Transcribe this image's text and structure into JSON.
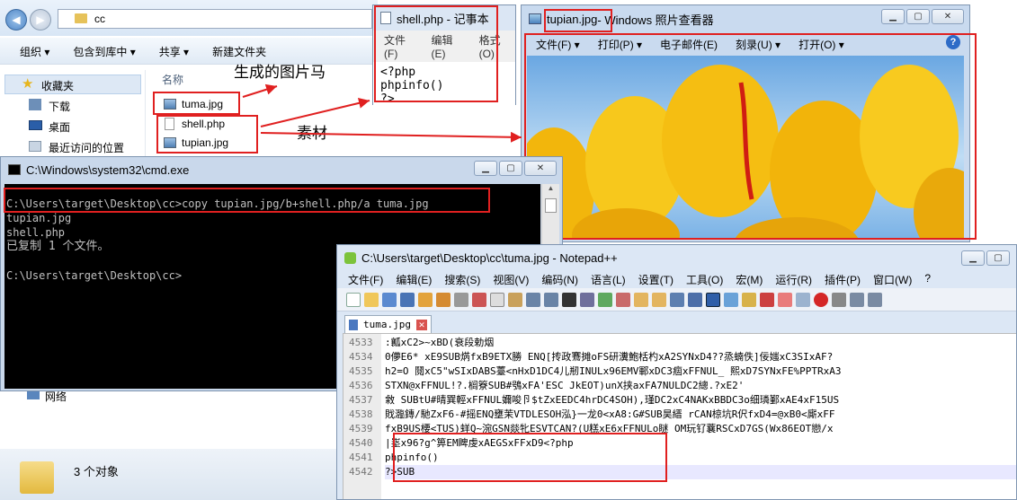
{
  "explorer": {
    "path": "cc",
    "toolbar": [
      "组织 ▾",
      "包含到库中 ▾",
      "共享 ▾",
      "新建文件夹"
    ],
    "column": "名称",
    "sidebar": [
      "收藏夹",
      "下载",
      "桌面",
      "最近访问的位置"
    ],
    "files": [
      "tuma.jpg",
      "shell.php",
      "tupian.jpg"
    ],
    "network": "网络",
    "count": "3 个对象"
  },
  "annotations": {
    "generated": "生成的图片马",
    "material": "素材"
  },
  "notepad": {
    "title": "shell.php - 记事本",
    "menu": [
      "文件(F)",
      "编辑(E)",
      "格式(O)"
    ],
    "lines": [
      "<?php",
      "phpinfo()",
      "?>"
    ]
  },
  "viewer": {
    "title_file": "tupian.jpg",
    "title_rest": " - Windows 照片查看器",
    "menu": [
      "文件(F) ▾",
      "打印(P) ▾",
      "电子邮件(E)",
      "刻录(U) ▾",
      "打开(O) ▾"
    ]
  },
  "cmd": {
    "title": "C:\\Windows\\system32\\cmd.exe",
    "command": "C:\\Users\\target\\Desktop\\cc>copy tupian.jpg/b+shell.php/a tuma.jpg",
    "out1": "tupian.jpg",
    "out2": "shell.php",
    "out3": "已复制         1 个文件。",
    "prompt": "C:\\Users\\target\\Desktop\\cc>"
  },
  "npp": {
    "title": "C:\\Users\\target\\Desktop\\cc\\tuma.jpg - Notepad++",
    "menu": [
      "文件(F)",
      "编辑(E)",
      "搜索(S)",
      "视图(V)",
      "编码(N)",
      "语言(L)",
      "设置(T)",
      "工具(O)",
      "宏(M)",
      "运行(R)",
      "插件(P)",
      "窗口(W)",
      "?"
    ],
    "tab": "tuma.jpg",
    "lines": [
      {
        "n": "4533",
        "t": ":瓤xC2>~xBD(衰段勅烟"
      },
      {
        "n": "4534",
        "t": "0儚E6*  xE9SUB焫fxB9ETX勝 ENQ[抟政鶱摊oFS研瀵鮑栝杓xA2SYNxD4??烝蝻佚]佞媸xC3SIxAF?"
      },
      {
        "n": "4535",
        "t": "h2=O  鬩xC5\"wSIxDABS薹<nHxD1DC4儿剏INULx96EMV鄆xDC3痼xFFNUL_ 熙xD7SYNxFE%PPTRxA3"
      },
      {
        "n": "4536",
        "t": "STXN@xFFNUL!?.榈簝SUB#鴞xFA'ESC  JkEOT)unX挟axFA7NULDC2總.?xE2'"
      },
      {
        "n": "4537",
        "t": "敹   SUBtU#晴巽輕xFFNUL嬭唆卪$tZxEEDC4hrDC4SOH),瑾DC2xC4NAKxBBDC3o细璘鄞xAE4xF15US"
      },
      {
        "n": "4538",
        "t": "戝瀶鏄/馳ZxF6-#摇ENQ壅茉VTDLESOH泓}一龙0<xA8:G#SUB昊縉  rCAN椋坑R伬fxD4=@xB0<廝xFF"
      },
      {
        "n": "4539",
        "t": "fxB9US楆<TUS)蛘Q~涴GSN燚牝ESVTCAN?(U糕xE6xFFNULo瞇  OM玩钌蘘RSCxD7GS(Wx86EOT戀/x"
      },
      {
        "n": "4540",
        "t": "|埊x96?g^箅EM睥虔xAEGSxFFxD9<?php"
      },
      {
        "n": "4541",
        "t": "phpinfo()"
      },
      {
        "n": "4542",
        "t": "?>SUB"
      }
    ]
  }
}
